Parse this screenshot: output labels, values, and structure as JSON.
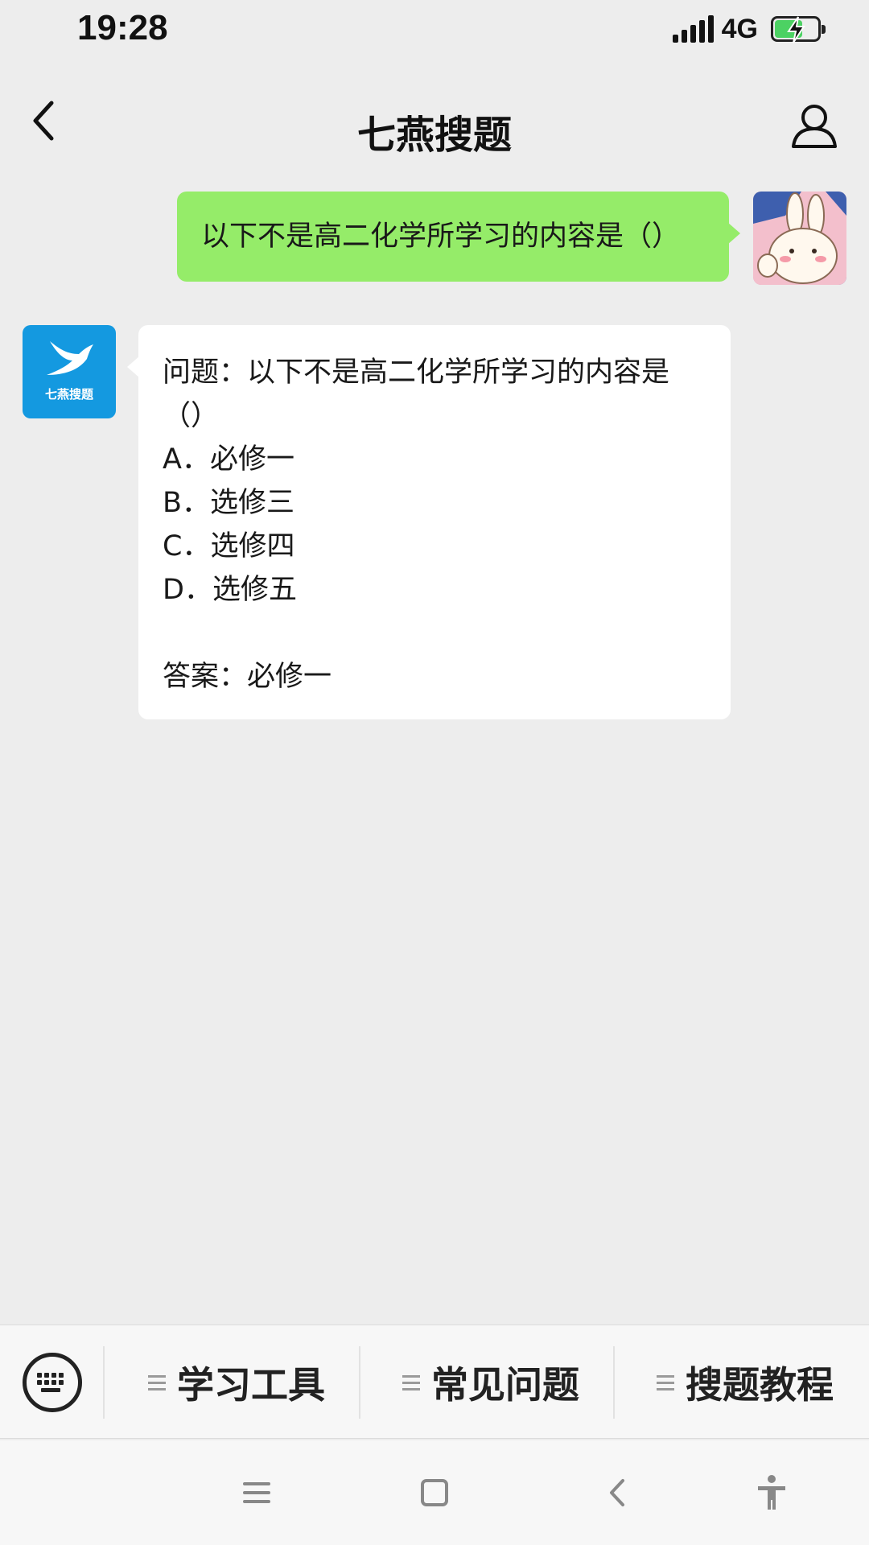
{
  "status_bar": {
    "time": "19:28",
    "network": "4G",
    "battery_level": 0.6,
    "charging": true
  },
  "nav": {
    "title": "七燕搜题",
    "back_icon": "chevron-left-icon",
    "profile_icon": "person-icon"
  },
  "chat": {
    "user_message": "以下不是高二化学所学习的内容是（）",
    "bot_name": "七燕搜题",
    "bot_reply": {
      "question_line1": "问题：以下不是高二化学所学习的内容是",
      "question_line2": "（）",
      "options": [
        "A．必修一",
        "B．选修三",
        "C．选修四",
        "D．选修五"
      ],
      "answer": "答案：必修一"
    }
  },
  "menu": {
    "keyboard_icon": "keyboard-icon",
    "items": [
      "学习工具",
      "常见问题",
      "搜题教程"
    ]
  },
  "system_nav": {
    "icons": [
      "menu-icon",
      "home-icon",
      "back-icon",
      "accessibility-icon"
    ]
  },
  "colors": {
    "user_bubble": "#95ec69",
    "bot_bubble": "#ffffff",
    "background": "#ededed",
    "bot_avatar": "#1499e0"
  }
}
